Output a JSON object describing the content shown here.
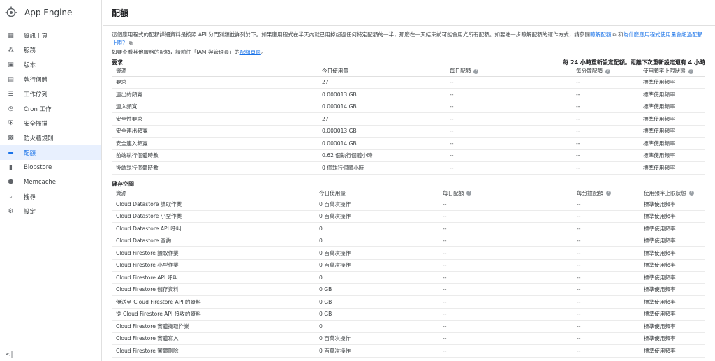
{
  "app": {
    "title": "App Engine"
  },
  "page": {
    "title": "配額"
  },
  "sidebar": {
    "items": [
      {
        "label": "資訊主頁",
        "icon": "dashboard-icon",
        "glyph": "▦"
      },
      {
        "label": "服務",
        "icon": "services-icon",
        "glyph": "⁂"
      },
      {
        "label": "版本",
        "icon": "versions-icon",
        "glyph": "▣"
      },
      {
        "label": "執行個體",
        "icon": "instances-icon",
        "glyph": "▤"
      },
      {
        "label": "工作佇列",
        "icon": "task-queue-icon",
        "glyph": "☰"
      },
      {
        "label": "Cron 工作",
        "icon": "cron-clock-icon",
        "glyph": "◷"
      },
      {
        "label": "安全掃描",
        "icon": "security-scan-icon",
        "glyph": "⛨"
      },
      {
        "label": "防火牆規則",
        "icon": "firewall-icon",
        "glyph": "▩"
      },
      {
        "label": "配額",
        "icon": "quotas-icon",
        "glyph": "▬",
        "active": true
      },
      {
        "label": "Blobstore",
        "icon": "blobstore-icon",
        "glyph": "▮"
      },
      {
        "label": "Memcache",
        "icon": "memcache-icon",
        "glyph": "⬢"
      },
      {
        "label": "搜尋",
        "icon": "search-icon",
        "glyph": "⌕"
      },
      {
        "label": "設定",
        "icon": "settings-gear-icon",
        "glyph": "⚙"
      }
    ],
    "collapse_glyph": "<|"
  },
  "intro": {
    "text1": "這個應用程式的配額詳細資料是按照 API 分門別類並詳列於下。如果應用程式在半天內就已用掉超過任何特定配額的一半，那麼在一天結束前可能會用光所有配額。如要進一步瞭解配額的運作方式，請參閱",
    "link1": "瞭解配額",
    "text2": "和",
    "link2": "為什麼應用程式使用量會超過配額上限？",
    "text3": "如要查看其他服務的配額，請前往「IAM 與管理員」的",
    "link3": "配額頁面",
    "text4": "。"
  },
  "requests": {
    "title": "要求",
    "reset_note": "每 24 小時重新設定配額。距離下次重新設定還有 4 小時",
    "columns": [
      "資源",
      "今日使用量",
      "每日配額",
      "每分鐘配額",
      "使用頻率上限狀態"
    ],
    "rows": [
      [
        "要求",
        "27",
        "--",
        "--",
        "標準使用頻率"
      ],
      [
        "連出的頻寬",
        "0.000013 GB",
        "--",
        "--",
        "標準使用頻率"
      ],
      [
        "連入頻寬",
        "0.000014 GB",
        "--",
        "--",
        "標準使用頻率"
      ],
      [
        "安全性要求",
        "27",
        "--",
        "--",
        "標準使用頻率"
      ],
      [
        "安全連出頻寬",
        "0.000013 GB",
        "--",
        "--",
        "標準使用頻率"
      ],
      [
        "安全連入頻寬",
        "0.000014 GB",
        "--",
        "--",
        "標準使用頻率"
      ],
      [
        "前端執行個體時數",
        "0.62 個執行個體小時",
        "--",
        "--",
        "標準使用頻率"
      ],
      [
        "後端執行個體時數",
        "0 個執行個體小時",
        "--",
        "--",
        "標準使用頻率"
      ]
    ]
  },
  "storage": {
    "title": "儲存空間",
    "columns": [
      "資源",
      "今日使用量",
      "每日配額",
      "每分鐘配額",
      "使用頻率上限狀態"
    ],
    "rows": [
      [
        "Cloud Datastore 讀取作業",
        "0 百萬次操作",
        "--",
        "--",
        "標準使用頻率"
      ],
      [
        "Cloud Datastore 小型作業",
        "0 百萬次操作",
        "--",
        "--",
        "標準使用頻率"
      ],
      [
        "Cloud Datastore API 呼叫",
        "0",
        "--",
        "--",
        "標準使用頻率"
      ],
      [
        "Cloud Datastore 查詢",
        "0",
        "--",
        "--",
        "標準使用頻率"
      ],
      [
        "Cloud Firestore 讀取作業",
        "0 百萬次操作",
        "--",
        "--",
        "標準使用頻率"
      ],
      [
        "Cloud Firestore 小型作業",
        "0 百萬次操作",
        "--",
        "--",
        "標準使用頻率"
      ],
      [
        "Cloud Firestore API 呼叫",
        "0",
        "--",
        "--",
        "標準使用頻率"
      ],
      [
        "Cloud Firestore 儲存資料",
        "0 GB",
        "--",
        "--",
        "標準使用頻率"
      ],
      [
        "傳送至 Cloud Firestore API 的資料",
        "0 GB",
        "--",
        "--",
        "標準使用頻率"
      ],
      [
        "從 Cloud Firestore API 接收的資料",
        "0 GB",
        "--",
        "--",
        "標準使用頻率"
      ],
      [
        "Cloud Firestore 實體擷取作業",
        "0",
        "--",
        "--",
        "標準使用頻率"
      ],
      [
        "Cloud Firestore 實體寫入",
        "0 百萬次操作",
        "--",
        "--",
        "標準使用頻率"
      ],
      [
        "Cloud Firestore 實體刪除",
        "0 百萬次操作",
        "--",
        "--",
        "標準使用頻率"
      ]
    ]
  },
  "colors": {
    "accent": "#1a73e8",
    "active_bg": "#e8f0fe"
  }
}
